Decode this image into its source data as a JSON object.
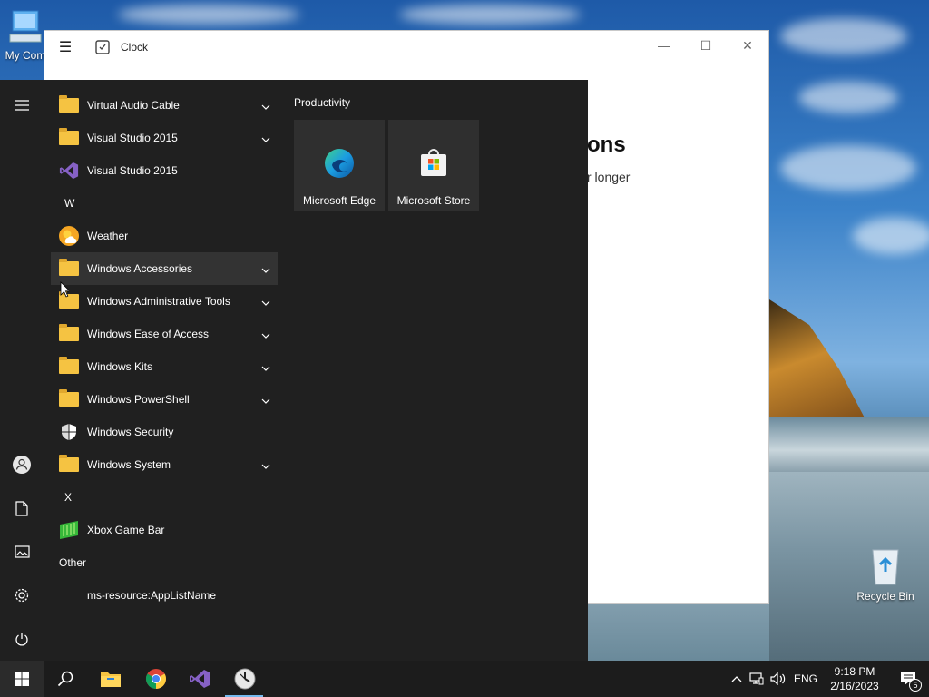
{
  "desktop": {
    "icons": [
      {
        "label": "My Com",
        "icon": "computer-icon"
      },
      {
        "label": "Recycle Bin",
        "icon": "recycle-bin-icon"
      }
    ]
  },
  "clock_window": {
    "title": "Clock",
    "heading_fragment": "ons",
    "subtext_fragment": "r longer",
    "controls": {
      "minimize": "—",
      "maximize": "☐",
      "close": "✕"
    }
  },
  "start_menu": {
    "app_list": [
      {
        "kind": "app",
        "label": "Virtual Audio Cable",
        "icon": "folder-icon",
        "expandable": true
      },
      {
        "kind": "app",
        "label": "Visual Studio 2015",
        "icon": "folder-icon",
        "expandable": true
      },
      {
        "kind": "app",
        "label": "Visual Studio 2015",
        "icon": "visual-studio-icon",
        "expandable": false
      },
      {
        "kind": "letter",
        "label": "W"
      },
      {
        "kind": "app",
        "label": "Weather",
        "icon": "weather-icon",
        "expandable": false
      },
      {
        "kind": "app",
        "label": "Windows Accessories",
        "icon": "folder-icon",
        "expandable": true,
        "hovered": true
      },
      {
        "kind": "app",
        "label": "Windows Administrative Tools",
        "icon": "folder-icon",
        "expandable": true
      },
      {
        "kind": "app",
        "label": "Windows Ease of Access",
        "icon": "folder-icon",
        "expandable": true
      },
      {
        "kind": "app",
        "label": "Windows Kits",
        "icon": "folder-icon",
        "expandable": true
      },
      {
        "kind": "app",
        "label": "Windows PowerShell",
        "icon": "folder-icon",
        "expandable": true
      },
      {
        "kind": "app",
        "label": "Windows Security",
        "icon": "shield-icon",
        "expandable": false
      },
      {
        "kind": "app",
        "label": "Windows System",
        "icon": "folder-icon",
        "expandable": true
      },
      {
        "kind": "letter",
        "label": "X"
      },
      {
        "kind": "app",
        "label": "Xbox Game Bar",
        "icon": "xbox-game-bar-icon",
        "expandable": false
      },
      {
        "kind": "group",
        "label": "Other"
      },
      {
        "kind": "app",
        "label": "ms-resource:AppListName",
        "icon": "",
        "expandable": false
      }
    ],
    "tiles_group": {
      "title": "Productivity",
      "tiles": [
        {
          "label": "Microsoft Edge",
          "icon": "edge-icon"
        },
        {
          "label": "Microsoft Store",
          "icon": "store-icon"
        }
      ]
    },
    "rail": [
      "hamburger-icon",
      "user-icon",
      "document-icon",
      "pictures-icon",
      "settings-icon",
      "power-icon"
    ]
  },
  "taskbar": {
    "pinned": [
      "windows-start-icon",
      "search-icon",
      "file-explorer-icon",
      "chrome-icon",
      "visual-studio-icon",
      "clock-icon"
    ],
    "tray": {
      "language": "ENG",
      "time": "9:18 PM",
      "date": "2/16/2023",
      "notification_count": "5"
    }
  },
  "colors": {
    "start_bg": "#202020",
    "hover_bg": "#333333",
    "folder": "#f5c342",
    "accent": "#76b9ed"
  }
}
